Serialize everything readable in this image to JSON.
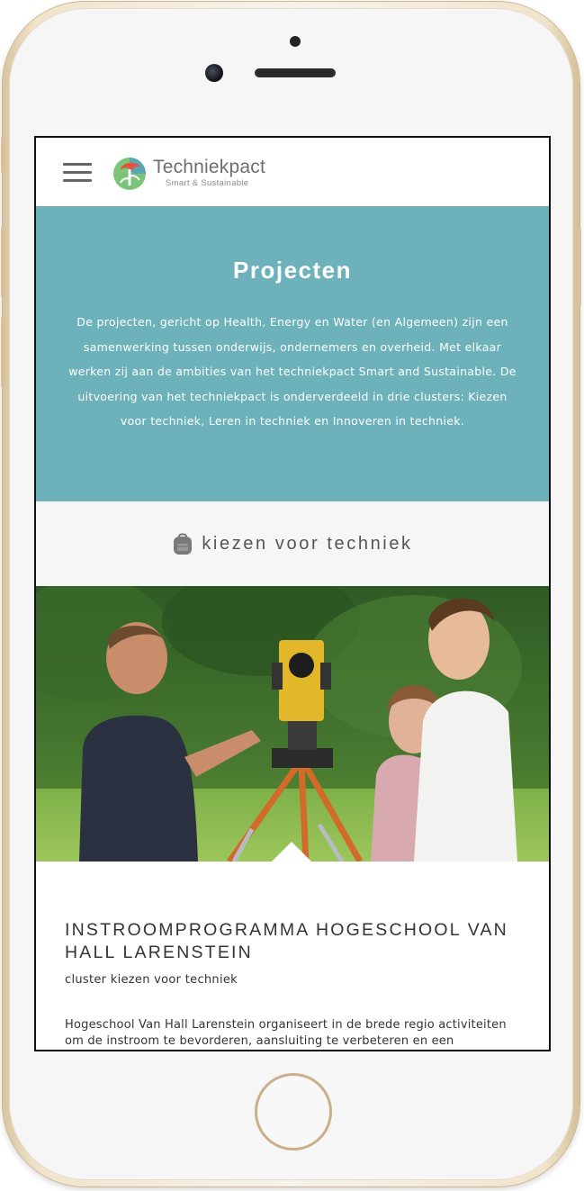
{
  "header": {
    "logo_name": "Techniekpact",
    "logo_tagline": "Smart & Sustainable"
  },
  "hero": {
    "title": "Projecten",
    "text": "De projecten, gericht op Health, Energy en Water (en Algemeen) zijn een samenwerking tussen onderwijs, ondernemers en overheid. Met elkaar werken zij aan de ambities van het techniekpact Smart and Sustainable. De uitvoering van het techniekpact is onderverdeeld in drie clusters: Kiezen voor techniek, Leren in techniek en Innoveren in techniek."
  },
  "cluster": {
    "icon": "backpack-icon",
    "title": "kiezen voor techniek"
  },
  "article": {
    "title": "INSTROOMPROGRAMMA HOGESCHOOL VAN HALL LARENSTEIN",
    "subtitle": "cluster kiezen voor techniek",
    "body": "Hogeschool Van Hall Larenstein organiseert in de brede regio activiteiten om de instroom te bevorderen, aansluiting te verbeteren en een structurele"
  },
  "colors": {
    "hero_bg": "#6db2ba",
    "cluster_bg": "#f6f6f6",
    "text_dark": "#333333"
  }
}
